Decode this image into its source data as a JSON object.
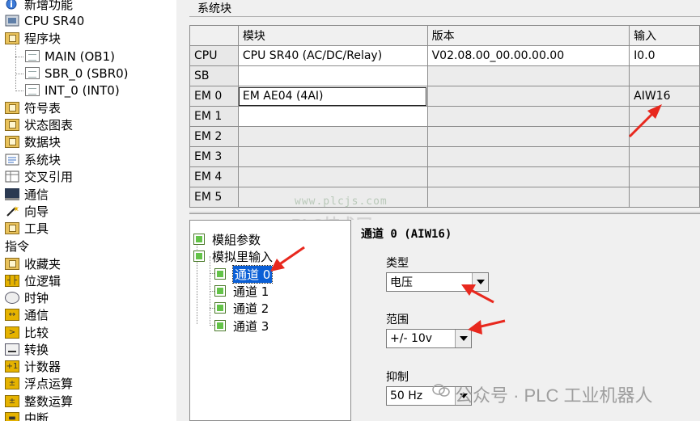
{
  "project_tree": {
    "items": [
      {
        "label": "新增功能",
        "icon": "info-icon"
      },
      {
        "label": "CPU SR40",
        "icon": "cpu-icon"
      },
      {
        "label": "程序块",
        "icon": "folder-icon"
      },
      {
        "label": "MAIN (OB1)",
        "icon": "program-block-icon"
      },
      {
        "label": "SBR_0 (SBR0)",
        "icon": "program-block-icon"
      },
      {
        "label": "INT_0 (INT0)",
        "icon": "program-block-icon"
      },
      {
        "label": "符号表",
        "icon": "folder-icon"
      },
      {
        "label": "状态图表",
        "icon": "folder-icon"
      },
      {
        "label": "数据块",
        "icon": "folder-icon"
      },
      {
        "label": "系统块",
        "icon": "system-block-icon"
      },
      {
        "label": "交叉引用",
        "icon": "cross-reference-icon"
      },
      {
        "label": "通信",
        "icon": "network-icon"
      },
      {
        "label": "向导",
        "icon": "wizard-icon"
      },
      {
        "label": "工具",
        "icon": "folder-icon"
      }
    ],
    "instructions_heading": "指令",
    "instruction_items": [
      {
        "label": "收藏夹",
        "icon": "folder-icon"
      },
      {
        "label": "位逻辑",
        "icon": "bit-logic-icon"
      },
      {
        "label": "时钟",
        "icon": "clock-icon"
      },
      {
        "label": "通信",
        "icon": "communication-icon"
      },
      {
        "label": "比较",
        "icon": "compare-icon"
      },
      {
        "label": "转换",
        "icon": "convert-icon"
      },
      {
        "label": "计数器",
        "icon": "counter-icon"
      },
      {
        "label": "浮点运算",
        "icon": "float-math-icon"
      },
      {
        "label": "整数运算",
        "icon": "integer-math-icon"
      },
      {
        "label": "中断",
        "icon": "interrupt-icon"
      }
    ]
  },
  "system_block": {
    "title": "系统块",
    "columns": [
      "",
      "模块",
      "版本",
      "输入"
    ],
    "rows": [
      {
        "slot": "CPU",
        "module": "CPU SR40 (AC/DC/Relay)",
        "version": "V02.08.00_00.00.00.00",
        "input": "I0.0"
      },
      {
        "slot": "SB",
        "module": "",
        "version": "",
        "input": ""
      },
      {
        "slot": "EM 0",
        "module": "EM AE04 (4AI)",
        "version": "",
        "input": "AIW16"
      },
      {
        "slot": "EM 1",
        "module": "",
        "version": "",
        "input": ""
      },
      {
        "slot": "EM 2",
        "module": "",
        "version": "",
        "input": ""
      },
      {
        "slot": "EM 3",
        "module": "",
        "version": "",
        "input": ""
      },
      {
        "slot": "EM 4",
        "module": "",
        "version": "",
        "input": ""
      },
      {
        "slot": "EM 5",
        "module": "",
        "version": "",
        "input": ""
      }
    ]
  },
  "param_tree": {
    "items": [
      {
        "label": "模組参数"
      },
      {
        "label": "模拟里输入"
      },
      {
        "label": "通道 0",
        "selected": true
      },
      {
        "label": "通道 1"
      },
      {
        "label": "通道 2"
      },
      {
        "label": "通道 3"
      }
    ]
  },
  "channel_detail": {
    "title": "通道 0 (AIW16)",
    "type_label": "类型",
    "type_value": "电压",
    "range_label": "范围",
    "range_value": "+/- 10v",
    "suppression_label": "抑制",
    "suppression_value": "50 Hz"
  },
  "watermarks": {
    "site": "www.plcjs.com",
    "brand": "PLC技术网",
    "credit": "公众号 · PLC 工业机器人"
  },
  "colors": {
    "annotation_arrow": "#e8281e",
    "selection": "#0a5fd6",
    "checkbox_green": "#63c348"
  }
}
